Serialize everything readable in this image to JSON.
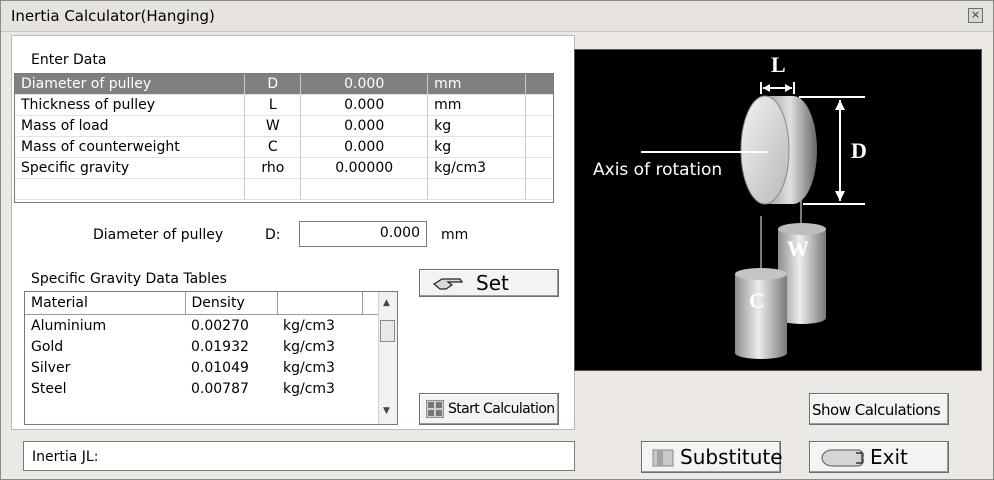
{
  "window": {
    "title": "Inertia Calculator(Hanging)"
  },
  "enter_data": {
    "heading": "Enter Data",
    "rows": [
      [
        "Diameter of pulley",
        "D",
        "0.000",
        "mm"
      ],
      [
        "Thickness of pulley",
        "L",
        "0.000",
        "mm"
      ],
      [
        "Mass of load",
        "W",
        "0.000",
        "kg"
      ],
      [
        "Mass of counterweight",
        "C",
        "0.000",
        "kg"
      ],
      [
        "Specific gravity",
        "rho",
        "0.00000",
        "kg/cm3"
      ]
    ]
  },
  "current_field": {
    "label": "Diameter of pulley",
    "symbol": "D:",
    "value": "0.000",
    "unit": "mm"
  },
  "gravity_table": {
    "heading": "Specific Gravity Data Tables",
    "columns": [
      "Material",
      "Density",
      ""
    ],
    "rows": [
      [
        "Aluminium",
        "0.00270",
        "kg/cm3"
      ],
      [
        "Gold",
        "0.01932",
        "kg/cm3"
      ],
      [
        "Silver",
        "0.01049",
        "kg/cm3"
      ],
      [
        "Steel",
        "0.00787",
        "kg/cm3"
      ]
    ]
  },
  "buttons": {
    "set": "Set",
    "start": "Start Calculation",
    "show": "Show Calculations",
    "substitute": "Substitute",
    "exit": "Exit"
  },
  "result": {
    "label": "Inertia JL:"
  },
  "diagram": {
    "axis_label": "Axis of rotation",
    "L": "L",
    "D": "D",
    "W": "W",
    "C": "C"
  },
  "icons": [
    "close-icon",
    "hand-pointer-icon",
    "calculator-icon",
    "substitute-icon",
    "exit-icon"
  ]
}
